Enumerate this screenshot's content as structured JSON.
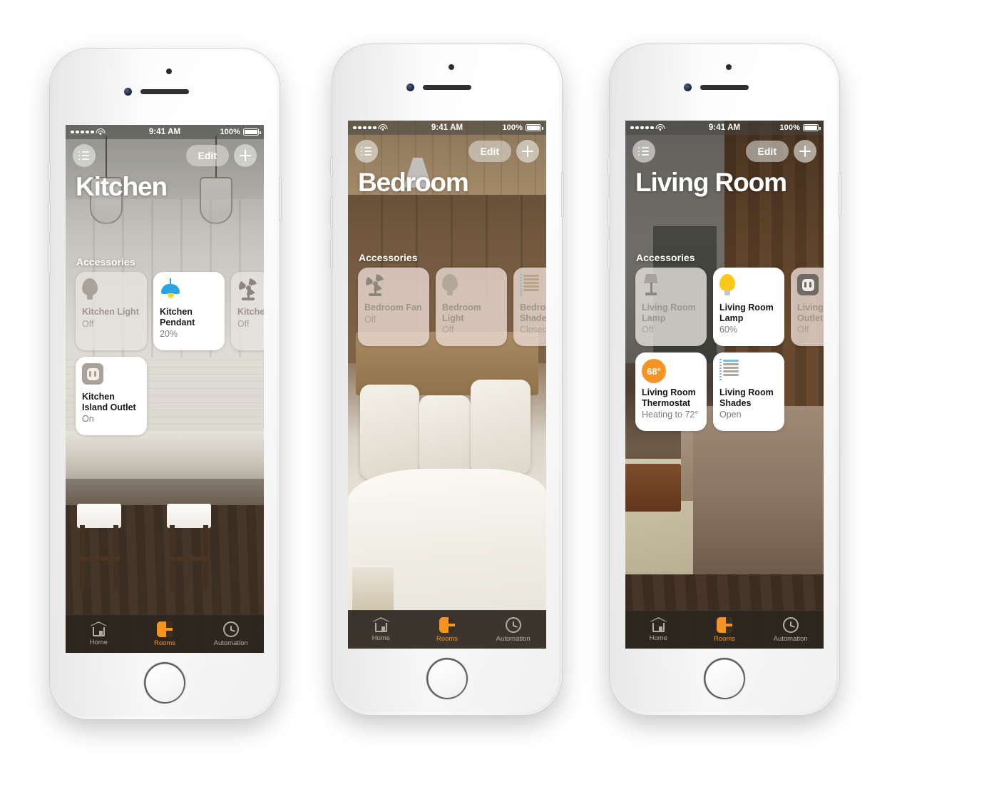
{
  "statusbar": {
    "time": "9:41 AM",
    "battery_percent": "100%",
    "signal_icon": "signal-dots-icon",
    "wifi_icon": "wifi-icon",
    "battery_icon": "battery-full-icon"
  },
  "nav": {
    "list_icon": "list-icon",
    "edit_label": "Edit",
    "add_icon": "plus-icon"
  },
  "section": {
    "accessories_label": "Accessories"
  },
  "tabbar": {
    "tabs": [
      {
        "label": "Home",
        "icon": "home-icon",
        "active": false
      },
      {
        "label": "Rooms",
        "icon": "rooms-icon",
        "active": true
      },
      {
        "label": "Automation",
        "icon": "automation-clock-icon",
        "active": false
      }
    ],
    "active_color": "#f5941f",
    "inactive_color": "#b4aca4",
    "background": "#2c2620"
  },
  "colors": {
    "accent_orange": "#f5941f",
    "thermostat_orange": "#f59425",
    "pendant_blue": "#2aa4e2",
    "bulb_yellow": "#ffc91c",
    "tile_on_bg": "#ffffff",
    "tile_off_bg": "#e8e4dc"
  },
  "phones": [
    {
      "room_title": "Kitchen",
      "background_scene": "kitchen-pendant-lights-island",
      "accessories": [
        {
          "name": "Kitchen Light",
          "state": "Off",
          "on": false,
          "icon": "bulb-icon",
          "tile_tint": "cool"
        },
        {
          "name": "Kitchen Pendant",
          "state": "20%",
          "on": true,
          "icon": "pendant-light-icon",
          "tile_tint": "none"
        },
        {
          "name": "Kitchen Fan",
          "state": "Off",
          "on": false,
          "icon": "fan-icon",
          "tile_tint": "cool"
        },
        {
          "name": "Kitchen Island Outlet",
          "state": "On",
          "on": true,
          "icon": "outlet-icon",
          "tile_tint": "none"
        }
      ]
    },
    {
      "room_title": "Bedroom",
      "background_scene": "bedroom-bed-pillows-wood-headboard",
      "accessories": [
        {
          "name": "Bedroom Fan",
          "state": "Off",
          "on": false,
          "icon": "fan-icon",
          "tile_tint": "warm"
        },
        {
          "name": "Bedroom Light",
          "state": "Off",
          "on": false,
          "icon": "bulb-icon",
          "tile_tint": "warm"
        },
        {
          "name": "Bedroom Shades",
          "state": "Closed",
          "on": false,
          "icon": "shades-icon",
          "tile_tint": "warm"
        }
      ]
    },
    {
      "room_title": "Living Room",
      "background_scene": "living-room-sofa-rug-wood-wall",
      "accessories": [
        {
          "name": "Living Room Lamp",
          "state": "Off",
          "on": false,
          "icon": "floor-lamp-icon",
          "tile_tint": "cool"
        },
        {
          "name": "Living Room Lamp",
          "state": "60%",
          "on": true,
          "icon": "bulb-icon",
          "tile_tint": "none"
        },
        {
          "name": "Living Room Outlet",
          "state": "Off",
          "on": false,
          "icon": "outlet-icon",
          "tile_tint": "warm"
        },
        {
          "name": "Living Room Thermostat",
          "state": "Heating to 72°",
          "on": true,
          "icon": "thermostat-icon",
          "temperature": "68°",
          "tile_tint": "none"
        },
        {
          "name": "Living Room Shades",
          "state": "Open",
          "on": true,
          "icon": "shades-icon",
          "tile_tint": "none"
        }
      ]
    }
  ]
}
